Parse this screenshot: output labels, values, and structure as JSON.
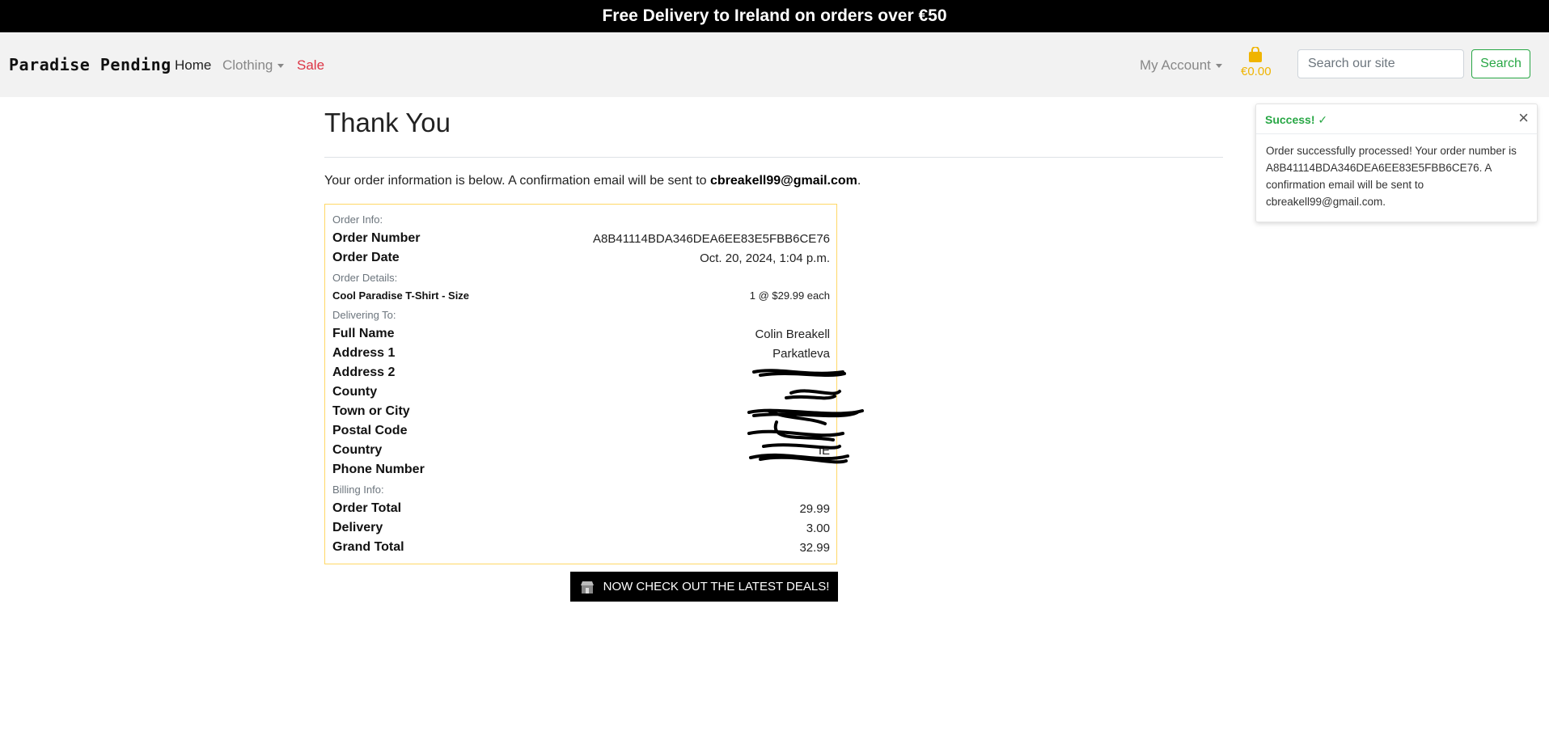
{
  "banner": {
    "text": "Free Delivery to Ireland on orders over €50"
  },
  "nav": {
    "brand": "Paradise Pending",
    "home": "Home",
    "clothing": "Clothing",
    "sale": "Sale",
    "account": "My Account",
    "bag_total": "€0.00",
    "search_placeholder": "Search our site",
    "search_button": "Search"
  },
  "page": {
    "title": "Thank You",
    "intro_text": "Your order information is below. A confirmation email will be sent to ",
    "email": "cbreakell99@gmail.com",
    "intro_end": "."
  },
  "order": {
    "info_header": "Order Info:",
    "number_label": "Order Number",
    "number_value": "A8B41114BDA346DEA6EE83E5FBB6CE76",
    "date_label": "Order Date",
    "date_value": "Oct. 20, 2024, 1:04 p.m.",
    "details_header": "Order Details:",
    "item_name": "Cool Paradise T-Shirt - Size",
    "item_qty": "1 @ $29.99 each",
    "delivery_header": "Delivering To:",
    "full_name_label": "Full Name",
    "full_name_value": "Colin Breakell",
    "address1_label": "Address 1",
    "address1_value": "Parkatleva",
    "address2_label": "Address 2",
    "county_label": "County",
    "town_label": "Town or City",
    "postal_label": "Postal Code",
    "country_label": "Country",
    "country_value": "IE",
    "phone_label": "Phone Number",
    "billing_header": "Billing Info:",
    "total_label": "Order Total",
    "total_value": "29.99",
    "delivery_label": "Delivery",
    "delivery_value": "3.00",
    "grand_label": "Grand Total",
    "grand_value": "32.99"
  },
  "deals_button": "NOW CHECK OUT THE LATEST DEALS!",
  "toast": {
    "title": "Success!",
    "body": "Order successfully processed! Your order number is A8B41114BDA346DEA6EE83E5FBB6CE76. A confirmation email will be sent to cbreakell99@gmail.com."
  },
  "colors": {
    "sale": "#dc3545",
    "bag": "#f0b400",
    "success": "#28a745",
    "box_border": "#ffd866"
  }
}
